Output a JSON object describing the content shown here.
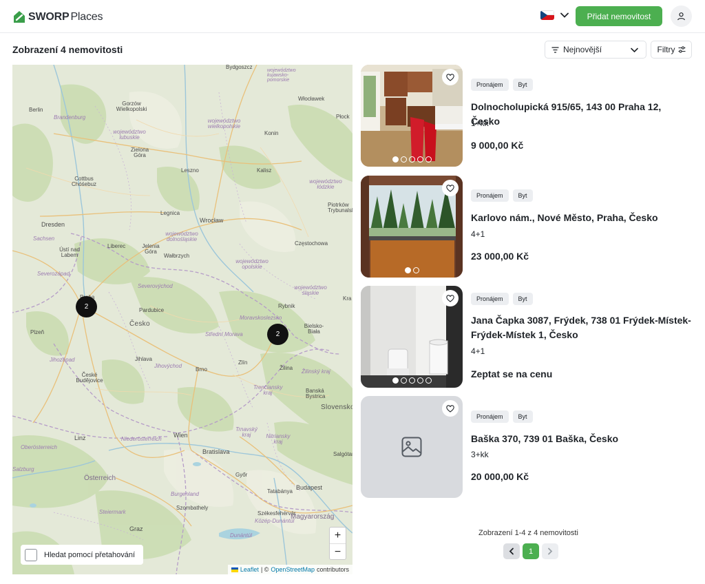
{
  "header": {
    "brand_bold": "SWORP",
    "brand_light": "Places",
    "language_icon": "czech-flag-icon",
    "add_button_label": "Přidat nemovitost"
  },
  "toolbar": {
    "results_title": "Zobrazení 4 nemovitosti",
    "sort_selected": "Nejnovější",
    "filters_label": "Filtry"
  },
  "map": {
    "labels": {
      "bydgoszcz": "Bydgoszcz",
      "woj_kujawsko": "województwo kujawsko-pomorskie",
      "berlin": "Berlin",
      "gorzow": "Gorzów Wielkopolski",
      "wloclawek": "Włocławek",
      "brandenburg": "Brandenburg",
      "woj_lubuskie": "województwo lubuskie",
      "woj_wielkopolskie": "województwo wielkopolskie",
      "konin": "Konin",
      "plock": "Płock",
      "zielona": "Zielona Góra",
      "leszno": "Leszno",
      "kalisz": "Kalisz",
      "cottbus": "Cottbus Chóśebuz",
      "woj_lodzkie": "województwo łódzkie",
      "piotrkow": "Piotrków Trybunalski",
      "legnica": "Legnica",
      "wroclaw": "Wrocław",
      "dresden": "Dresden",
      "woj_dolnoslaskie": "województwo dolnośląskie",
      "sachsen": "Sachsen",
      "usti": "Ústí nad Labem",
      "liberec": "Liberec",
      "jelenia": "Jelenia Góra",
      "walbrzych": "Wałbrzych",
      "czestochowa": "Częstochowa",
      "woj_opolskie": "województwo opolskie",
      "severozapad": "Severozápad",
      "severovychod": "Severovýchod",
      "praha": "Praha",
      "pardubice": "Pardubice",
      "woj_slaskie": "województwo śląskie",
      "rybnik": "Rybnik",
      "krakow": "Kra",
      "cesko": "Česko",
      "moravskoslezsko": "Moravskoslezsko",
      "bielsko": "Bielsko-Biała",
      "plzen": "Plzeň",
      "stredni_morava": "Střední Morava",
      "jihozapad": "Jihozápad",
      "jihlava": "Jihlava",
      "zlin": "Zlín",
      "zilina": "Žilina",
      "jihovychod": "Jihovýchod",
      "brno": "Brno",
      "zilinsky": "Žilinský kraj",
      "ceske_budejovice": "České Budějovice",
      "trenciansky": "Trenčiansky kraj",
      "banska": "Banská Bystrica",
      "slovensko": "Slovensko",
      "trnavsky": "Trnavský kraj",
      "nitriansky": "Nitriansky kraj",
      "linz": "Linz",
      "wien": "Wien",
      "niederosterreich": "Niederösterreich",
      "bratislava": "Bratislava",
      "salgotarjan": "Salgótar",
      "oberosterreich": "Oberösterreich",
      "osterreich": "Österreich",
      "gyor": "Győr",
      "burgenland": "Burgenland",
      "tatabanya": "Tatabánya",
      "budapest": "Budapest",
      "salzburg": "Salzburg",
      "steiermark": "Steiermark",
      "szombathely": "Szombathely",
      "szekesfehervar": "Székesfehérvár",
      "magyarorszag": "Magyarország",
      "graz": "Graz",
      "dunantul": "Dunántúl",
      "kozep": "Közép-Dunántúl"
    },
    "clusters": [
      {
        "count": "2"
      },
      {
        "count": "2"
      }
    ],
    "zoom_in": "+",
    "zoom_out": "−",
    "drag_search_label": "Hledat pomocí přetahování",
    "attribution_leaflet": "Leaflet",
    "attribution_sep": "| ©",
    "attribution_osm": "OpenStreetMap",
    "attribution_contrib": "contributors"
  },
  "listings": [
    {
      "tags": [
        "Pronájem",
        "Byt"
      ],
      "address": "Dolnocholupická 915/65, 143 00 Praha 12, Česko",
      "layout": "1+kk",
      "price": "9 000,00 Kč",
      "image": "kitchen-photo",
      "dots": 5
    },
    {
      "tags": [
        "Pronájem",
        "Byt"
      ],
      "address": "Karlovo nám., Nové Město, Praha, Česko",
      "layout": "4+1",
      "price": "23 000,00 Kč",
      "image": "balcony-photo",
      "dots": 2
    },
    {
      "tags": [
        "Pronájem",
        "Byt"
      ],
      "address": "Jana Čapka 3087, Frýdek, 738 01 Frýdek-Místek-Frýdek-Místek 1, Česko",
      "layout": "4+1",
      "price": "Zeptat se na cenu",
      "image": "bathroom-photo",
      "dots": 5
    },
    {
      "tags": [
        "Pronájem",
        "Byt"
      ],
      "address": "Baška 370, 739 01 Baška, Česko",
      "layout": "3+kk",
      "price": "20 000,00 Kč",
      "image": "image-placeholder-icon",
      "dots": 0
    }
  ],
  "pagination": {
    "info": "Zobrazení 1-4 z 4 nemovitosti",
    "current_page": "1"
  },
  "colors": {
    "accent": "#4caf50",
    "map_bg": "#e6eadc",
    "cluster": "#111111"
  }
}
